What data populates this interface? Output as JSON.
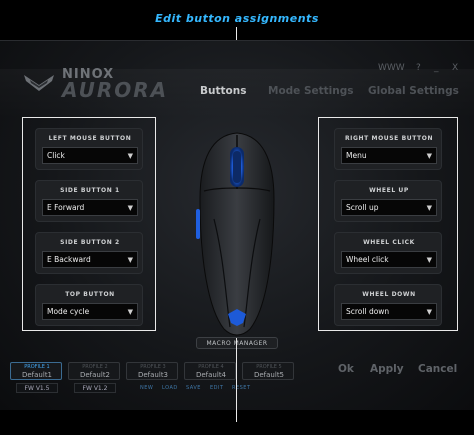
{
  "callouts": {
    "top": "Edit button assignments",
    "bottom": ""
  },
  "brand": {
    "line1": "NINOX",
    "line2": "AURORA"
  },
  "window_controls": [
    "WWW",
    "?",
    "_",
    "X"
  ],
  "tabs": [
    {
      "label": "Buttons",
      "active": true
    },
    {
      "label": "Mode Settings",
      "active": false
    },
    {
      "label": "Global Settings",
      "active": false
    }
  ],
  "left_buttons": [
    {
      "label": "LEFT MOUSE BUTTON",
      "value": "Click"
    },
    {
      "label": "SIDE BUTTON 1",
      "value": "E Forward"
    },
    {
      "label": "SIDE BUTTON 2",
      "value": "E Backward"
    },
    {
      "label": "TOP BUTTON",
      "value": "Mode cycle"
    }
  ],
  "right_buttons": [
    {
      "label": "RIGHT MOUSE BUTTON",
      "value": "Menu"
    },
    {
      "label": "WHEEL UP",
      "value": "Scroll up"
    },
    {
      "label": "WHEEL CLICK",
      "value": "Wheel click"
    },
    {
      "label": "WHEEL DOWN",
      "value": "Scroll down"
    }
  ],
  "macro_manager": "MACRO MANAGER",
  "profiles": [
    {
      "label": "PROFILE 1",
      "name": "Default1",
      "active": true
    },
    {
      "label": "PROFILE 2",
      "name": "Default2",
      "active": false
    },
    {
      "label": "PROFILE 3",
      "name": "Default3",
      "active": false
    },
    {
      "label": "PROFILE 4",
      "name": "Default4",
      "active": false
    },
    {
      "label": "PROFILE 5",
      "name": "Default5",
      "active": false
    }
  ],
  "firmware": [
    "FW V1.5",
    "FW V1.2"
  ],
  "profile_actions": [
    "NEW",
    "LOAD",
    "SAVE",
    "EDIT",
    "RESET"
  ],
  "footer_buttons": {
    "ok": "Ok",
    "apply": "Apply",
    "cancel": "Cancel"
  },
  "colors": {
    "accent": "#35b8ff",
    "led": "#2a6cff"
  }
}
